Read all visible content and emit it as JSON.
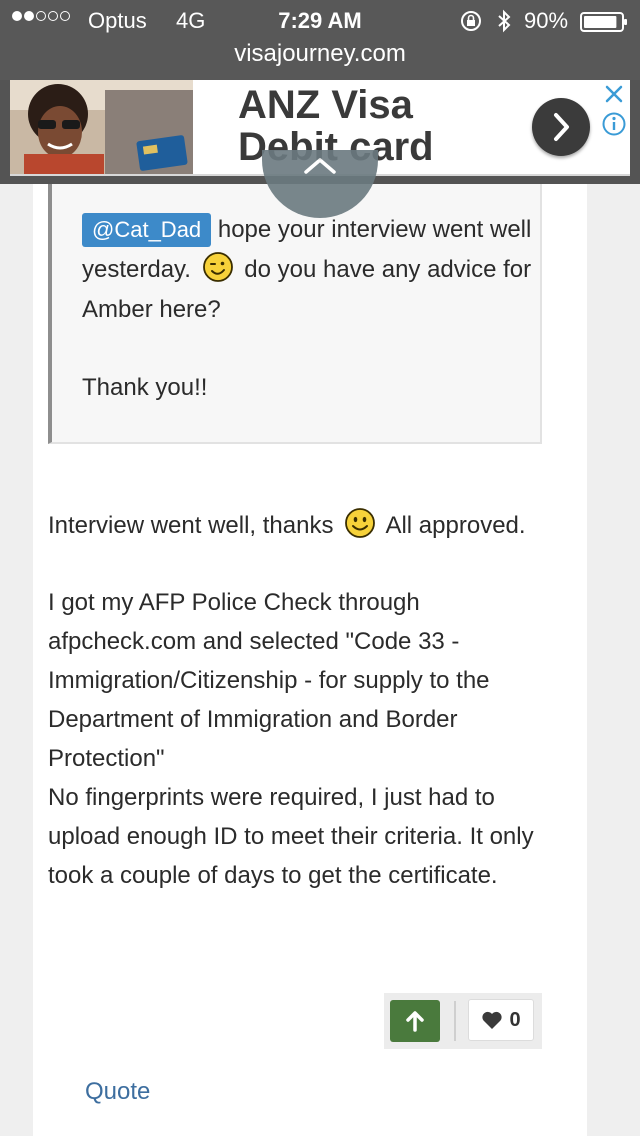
{
  "status": {
    "carrier": "Optus",
    "network": "4G",
    "time": "7:29 AM",
    "battery": "90%",
    "battery_level": 0.9,
    "signal_bars_filled": 2,
    "signal_bars_total": 5
  },
  "browser": {
    "url": "visajourney.com"
  },
  "ad": {
    "headline_line1": "ANZ Visa",
    "headline_line2": "Debit card",
    "close_icon": "close-icon",
    "info_icon": "info-icon",
    "go_icon": "chevron-right-icon"
  },
  "quote": {
    "mention": "@Cat_Dad",
    "text1": " hope your interview went well yesterday. ",
    "text2": " do you have any advice for Amber here?",
    "text3": "Thank you!!",
    "emoji": "winking-smiley-icon"
  },
  "post": {
    "line1a": "Interview went well, thanks ",
    "line1b": " All approved.",
    "para2": "I got my AFP Police Check through afpcheck.com and selected \"Code 33 - Immigration/Citizenship - for supply to the Department of Immigration and Border Protection\"",
    "para3": "No fingerprints were required, I just had to upload enough ID to meet their criteria. It only took a couple of days to get the certificate.",
    "emoji": "smiley-icon"
  },
  "actions": {
    "like_count": "0",
    "quote_label": "Quote",
    "upvote_icon": "arrow-up-icon",
    "like_icon": "heart-icon"
  },
  "colors": {
    "upvote": "#4a7a3d",
    "mention": "#3d8ac9",
    "link": "#3d6e9f"
  }
}
